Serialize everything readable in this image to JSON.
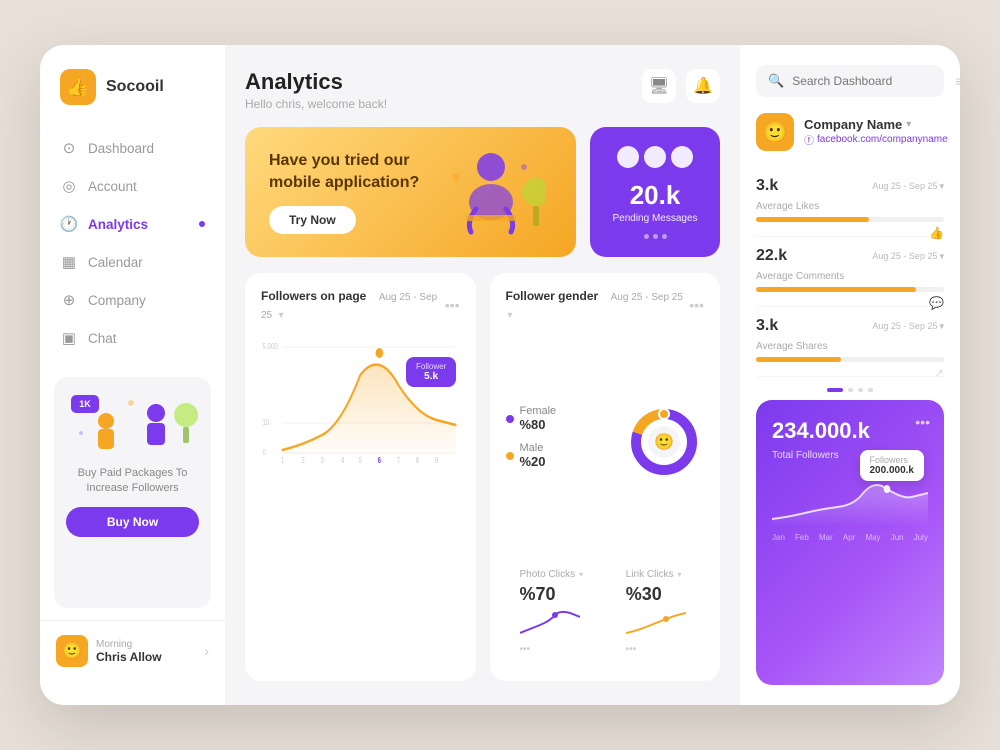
{
  "app": {
    "name": "Socooil"
  },
  "sidebar": {
    "nav": [
      {
        "id": "dashboard",
        "label": "Dashboard",
        "icon": "⊙",
        "active": false
      },
      {
        "id": "account",
        "label": "Account",
        "icon": "◎",
        "active": false
      },
      {
        "id": "analytics",
        "label": "Analytics",
        "icon": "🕐",
        "active": true
      },
      {
        "id": "calendar",
        "label": "Calendar",
        "icon": "▦",
        "active": false
      },
      {
        "id": "company",
        "label": "Company",
        "icon": "⊕",
        "active": false
      },
      {
        "id": "chat",
        "label": "Chat",
        "icon": "▣",
        "active": false
      }
    ],
    "promo": {
      "badge": "1K",
      "text": "Buy Paid Packages To Increase Followers",
      "button": "Buy Now"
    },
    "user": {
      "greeting": "Morning",
      "name": "Chris Allow"
    }
  },
  "header": {
    "title": "Analytics",
    "subtitle": "Hello chris, welcome back!"
  },
  "banner": {
    "promo_text": "Have you tried our mobile application?",
    "try_button": "Try Now",
    "messages_count": "20.k",
    "messages_label": "Pending Messages"
  },
  "followers_chart": {
    "title": "Followers on page",
    "date_range": "Aug 25 - Sep 25",
    "tooltip_label": "Follower",
    "tooltip_value": "5.k",
    "y_labels": [
      "5.000",
      "10",
      "0"
    ],
    "x_labels": [
      "1",
      "2",
      "3",
      "4",
      "5",
      "6",
      "7",
      "8",
      "9"
    ]
  },
  "gender_chart": {
    "title": "Follower gender",
    "date_range": "Aug 25 - Sep 25",
    "items": [
      {
        "label": "Female",
        "pct": "%80",
        "color": "#7c3aed"
      },
      {
        "label": "Male",
        "pct": "%20",
        "color": "#f5a623"
      }
    ]
  },
  "mini_cards": [
    {
      "title": "Photo Clicks",
      "value": "%70"
    },
    {
      "title": "Link Clicks",
      "value": "%30"
    }
  ],
  "right_panel": {
    "search_placeholder": "Search Dashboard",
    "company": {
      "name": "Company Name",
      "url": "facebook.com/companyname"
    },
    "stats": [
      {
        "value": "3.k",
        "label": "Average Likes",
        "bar_pct": 60,
        "date": "Aug 25 - Sep 25"
      },
      {
        "value": "22.k",
        "label": "Average Comments",
        "bar_pct": 85,
        "date": "Aug 25 - Sep 25"
      },
      {
        "value": "3.k",
        "label": "Average Shares",
        "bar_pct": 45,
        "date": "Aug 25 - Sep 25"
      }
    ],
    "total_followers": {
      "value": "234.000.k",
      "label": "Total Followers",
      "tooltip_label": "Followers",
      "tooltip_value": "200.000.k",
      "months": [
        "Jan",
        "Feb",
        "Mar",
        "Apr",
        "May",
        "Jun",
        "July"
      ]
    }
  }
}
